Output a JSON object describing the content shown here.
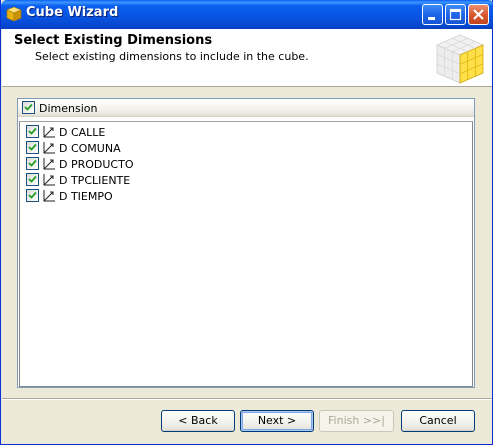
{
  "window": {
    "title": "Cube Wizard"
  },
  "header": {
    "title": "Select Existing Dimensions",
    "subtitle": "Select existing dimensions to include in the cube."
  },
  "list": {
    "column_header": "Dimension",
    "header_checked": true,
    "items": [
      {
        "label": "D CALLE",
        "checked": true,
        "icon": "dimension-icon"
      },
      {
        "label": "D COMUNA",
        "checked": true,
        "icon": "dimension-icon"
      },
      {
        "label": "D PRODUCTO",
        "checked": true,
        "icon": "dimension-icon"
      },
      {
        "label": "D TPCLIENTE",
        "checked": true,
        "icon": "dimension-icon"
      },
      {
        "label": "D TIEMPO",
        "checked": true,
        "icon": "dimension-icon"
      }
    ]
  },
  "buttons": {
    "back": "< Back",
    "next": "Next >",
    "finish": "Finish >>|",
    "cancel": "Cancel"
  },
  "colors": {
    "titlebar": "#0853e0",
    "checkmark": "#21a121",
    "face": "#ece9d8"
  }
}
